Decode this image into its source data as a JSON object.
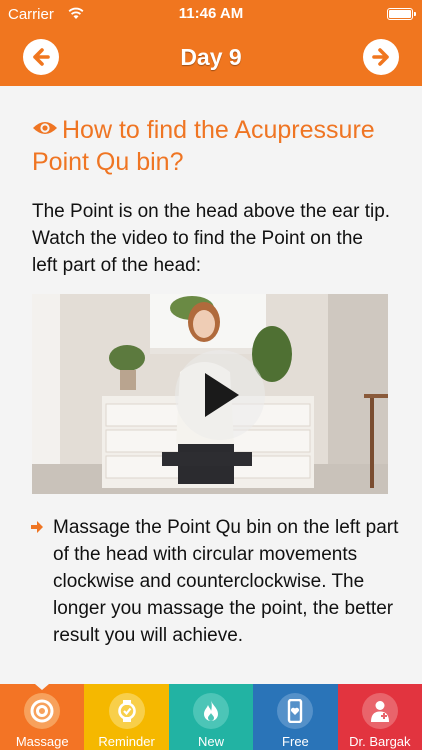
{
  "status_bar": {
    "carrier": "Carrier",
    "time": "11:46 AM"
  },
  "nav": {
    "title": "Day 9",
    "prev_icon": "arrow-left-circle",
    "next_icon": "arrow-right-circle"
  },
  "content": {
    "heading": "How to find the Acupressure Point Qu bin?",
    "intro": "The Point is on the head above the ear tip. Watch the video to find the Point on the left part of the head:",
    "bullet": "Massage the Point Qu bin on the left part of the head with circular movements clockwise and counterclockwise. The longer you massage the point, the better result you will achieve."
  },
  "tabs": [
    {
      "label": "Massage",
      "color": "#f37425",
      "icon": "target-icon"
    },
    {
      "label": "Reminder",
      "color": "#f5b800",
      "icon": "watch-icon"
    },
    {
      "label": "New",
      "color": "#22b3a3",
      "icon": "flame-icon"
    },
    {
      "label": "Free",
      "color": "#2a74b8",
      "icon": "phone-heart-icon"
    },
    {
      "label": "Dr. Bargak",
      "color": "#e2343f",
      "icon": "doctor-icon"
    }
  ],
  "colors": {
    "brand": "#f0761f",
    "heading": "#ef7523"
  }
}
